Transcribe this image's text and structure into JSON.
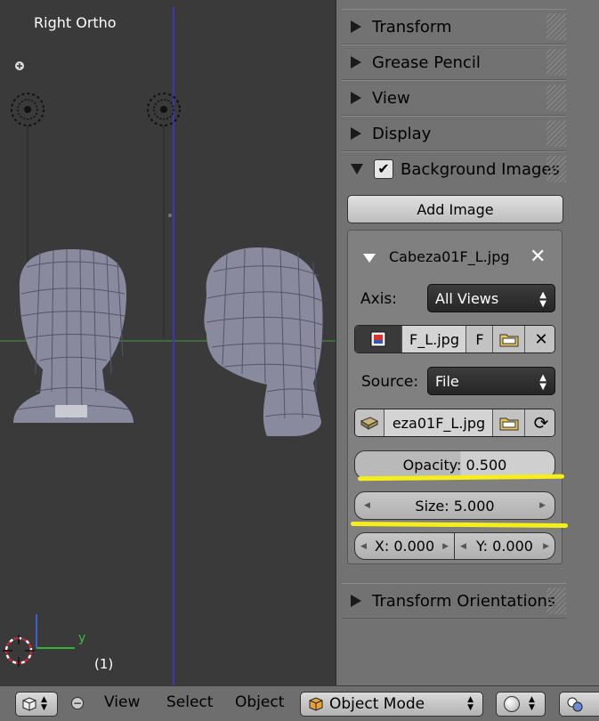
{
  "viewport": {
    "view_label": "Right Ortho",
    "frame_label": "(1)",
    "axis_y_label": "y"
  },
  "properties": {
    "panels": {
      "transform": "Transform",
      "grease_pencil": "Grease Pencil",
      "view": "View",
      "display": "Display",
      "background_images": "Background Images",
      "transform_orientations": "Transform Orientations"
    },
    "background_images_enabled": true,
    "add_image_label": "Add Image",
    "image_entry": {
      "name": "Cabeza01F_L.jpg",
      "axis_label": "Axis:",
      "axis_value": "All Views",
      "image_datablock": "F_L.jpg",
      "fake_user": "F",
      "source_label": "Source:",
      "source_value": "File",
      "filepath": "eza01F_L.jpg",
      "opacity_label": "Opacity:",
      "opacity_value": "0.500",
      "size_label": "Size:",
      "size_value": "5.000",
      "x_label": "X:",
      "x_value": "0.000",
      "y_label": "Y:",
      "y_value": "0.000"
    },
    "highlight_color": "#f5ee1a"
  },
  "header": {
    "view": "View",
    "select": "Select",
    "object": "Object",
    "mode": "Object Mode"
  }
}
